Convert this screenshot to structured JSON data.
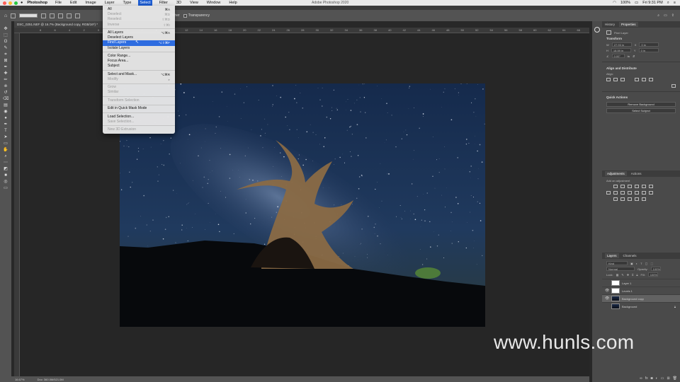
{
  "menubar": {
    "app_name": "Photoshop",
    "items": [
      "File",
      "Edit",
      "Image",
      "Layer",
      "Type",
      "Select",
      "Filter",
      "3D",
      "View",
      "Window",
      "Help"
    ],
    "active": "Select",
    "window_title": "Adobe Photoshop 2020",
    "battery": "100%",
    "clock": "Fri 9:31 PM"
  },
  "options_bar": {
    "dither_label": "Dither",
    "transparency_label": "Transparency"
  },
  "document_tab": {
    "title": "DSC_0251.NEF @ 16.7% (Background copy, RGB/16*) *"
  },
  "ruler": {
    "ticks": [
      "8",
      "6",
      "4",
      "2",
      "0",
      "2",
      "4",
      "6",
      "8",
      "10",
      "12",
      "14",
      "16",
      "18",
      "20",
      "22",
      "24",
      "26",
      "28",
      "30",
      "32",
      "34",
      "36",
      "38",
      "40",
      "42",
      "44",
      "46",
      "48",
      "50",
      "52",
      "54",
      "56",
      "58",
      "60",
      "62",
      "64",
      "66"
    ]
  },
  "select_menu": {
    "items": [
      {
        "label": "All",
        "shortcut": "⌘A",
        "state": "normal"
      },
      {
        "label": "Deselect",
        "shortcut": "⌘D",
        "state": "disabled"
      },
      {
        "label": "Reselect",
        "shortcut": "⇧⌘D",
        "state": "disabled"
      },
      {
        "label": "Inverse",
        "shortcut": "⇧⌘I",
        "state": "disabled"
      },
      {
        "sep": true
      },
      {
        "label": "All Layers",
        "shortcut": "⌥⌘A",
        "state": "normal"
      },
      {
        "label": "Deselect Layers",
        "shortcut": "",
        "state": "normal"
      },
      {
        "label": "Find Layers",
        "shortcut": "⌥⇧⌘F",
        "state": "highlighted"
      },
      {
        "label": "Isolate Layers",
        "shortcut": "",
        "state": "normal"
      },
      {
        "sep": true
      },
      {
        "label": "Color Range...",
        "shortcut": "",
        "state": "normal"
      },
      {
        "label": "Focus Area...",
        "shortcut": "",
        "state": "normal"
      },
      {
        "label": "Subject",
        "shortcut": "",
        "state": "normal"
      },
      {
        "sep": true
      },
      {
        "label": "Select and Mask...",
        "shortcut": "⌥⌘R",
        "state": "normal"
      },
      {
        "label": "Modify",
        "shortcut": "▸",
        "state": "disabled"
      },
      {
        "sep": true
      },
      {
        "label": "Grow",
        "shortcut": "",
        "state": "disabled"
      },
      {
        "label": "Similar",
        "shortcut": "",
        "state": "disabled"
      },
      {
        "sep": true
      },
      {
        "label": "Transform Selection",
        "shortcut": "",
        "state": "disabled"
      },
      {
        "sep": true
      },
      {
        "label": "Edit in Quick Mask Mode",
        "shortcut": "",
        "state": "normal"
      },
      {
        "sep": true
      },
      {
        "label": "Load Selection...",
        "shortcut": "",
        "state": "normal"
      },
      {
        "label": "Save Selection...",
        "shortcut": "",
        "state": "disabled"
      },
      {
        "sep": true
      },
      {
        "label": "New 3D Extrusion",
        "shortcut": "",
        "state": "disabled"
      }
    ]
  },
  "properties_panel": {
    "tabs": [
      "History",
      "Properties"
    ],
    "active_tab": "Properties",
    "layer_type": "Pixel Layer",
    "transform_title": "Transform",
    "w_label": "W",
    "w_value": "27.93 in",
    "h_label": "H",
    "h_value": "18.59 in",
    "x_label": "X",
    "x_value": "0 in",
    "y_label": "Y",
    "y_value": "0 in",
    "angle_value": "0.00°",
    "align_title": "Align and Distribute",
    "align_label": "Align:",
    "quick_actions_title": "Quick Actions",
    "remove_bg_label": "Remove Background",
    "select_subject_label": "Select Subject"
  },
  "adjustments_panel": {
    "tabs": [
      "Adjustments",
      "Actions"
    ],
    "active_tab": "Adjustments",
    "subtitle": "Add an adjustment"
  },
  "layers_panel": {
    "tabs": [
      "Layers",
      "Channels"
    ],
    "active_tab": "Layers",
    "filter_label": "Kind",
    "blend_mode": "Normal",
    "opacity_label": "Opacity:",
    "opacity_value": "100%",
    "lock_label": "Lock:",
    "fill_label": "Fill:",
    "fill_value": "100%",
    "layers": [
      {
        "name": "Layer 1",
        "visible": false,
        "thumb": "white",
        "selected": false
      },
      {
        "name": "Levels 1",
        "visible": true,
        "thumb": "white",
        "selected": false
      },
      {
        "name": "Background copy",
        "visible": true,
        "thumb": "sky",
        "selected": true
      },
      {
        "name": "Background",
        "visible": false,
        "thumb": "sky",
        "selected": false
      }
    ]
  },
  "status_bar": {
    "zoom": "16.67%",
    "doc_size": "Doc: 360.0M/521.0M"
  },
  "watermark": "www.hunls.com",
  "colors": {
    "accent": "#2d6ce0",
    "panel_bg": "#4a4a4a",
    "canvas_bg": "#262626"
  }
}
